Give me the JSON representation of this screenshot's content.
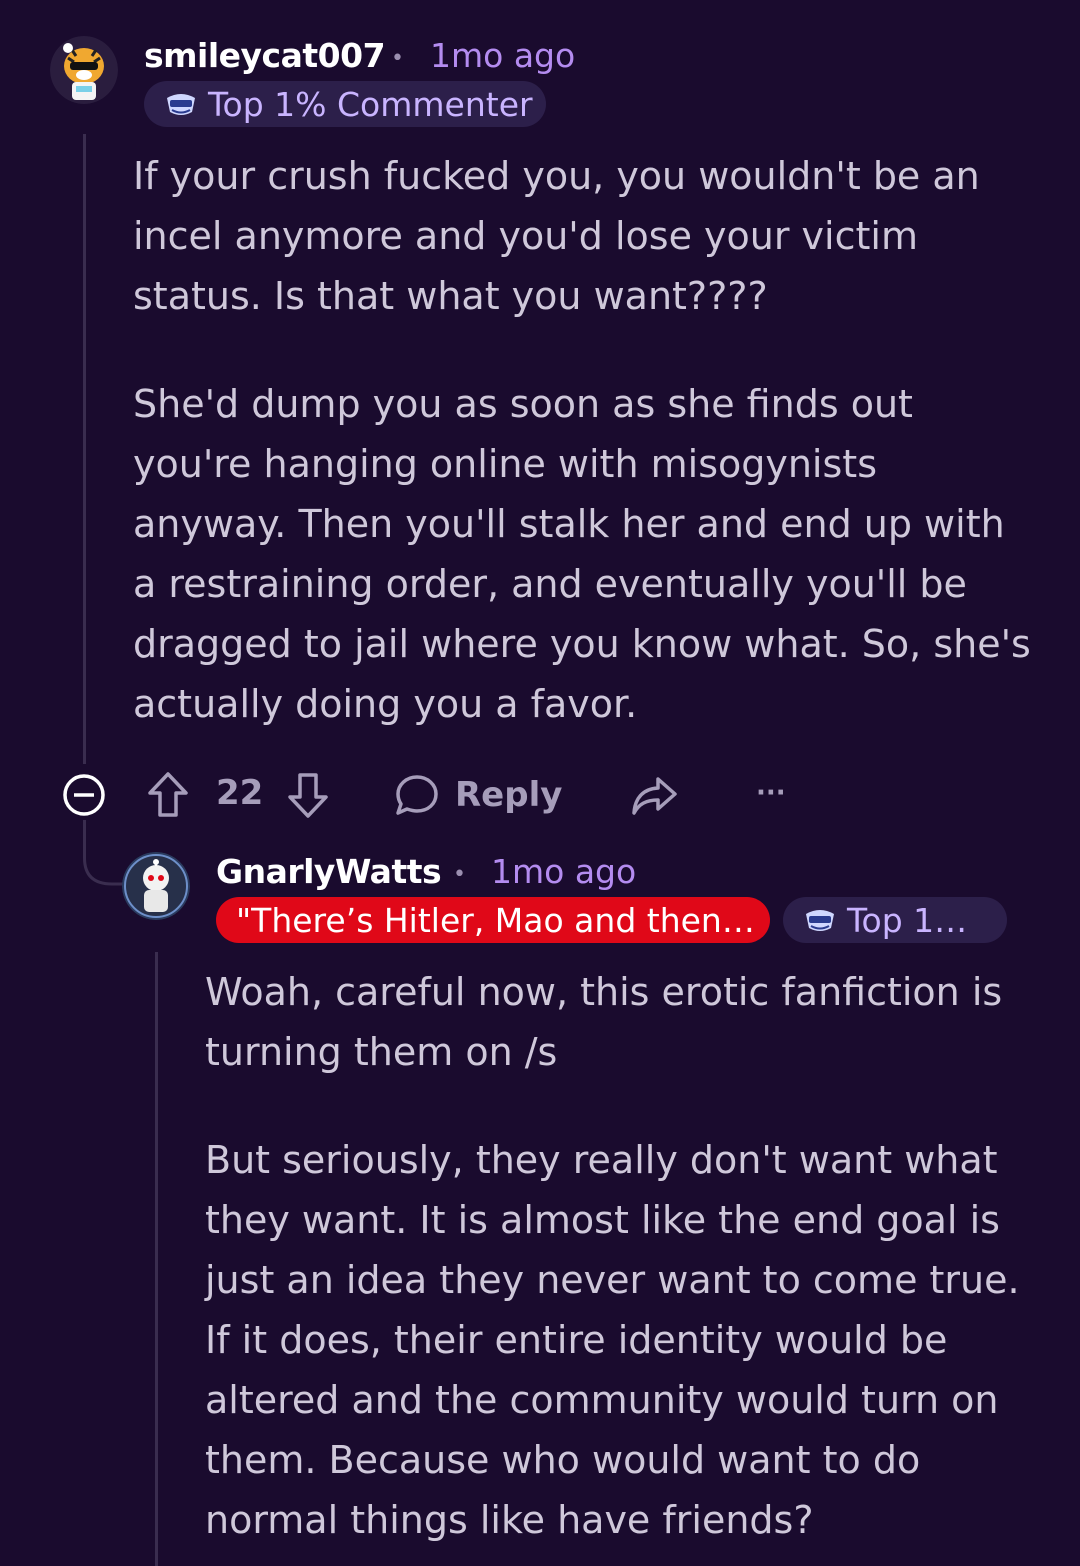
{
  "comments": [
    {
      "username": "smileycat007",
      "separator": "•",
      "time": "1mo ago",
      "flair": "Top 1% Commenter",
      "paragraphs": [
        "If your crush fucked you, you wouldn't be an incel anymore and you'd lose your victim status. Is that what you want????",
        "She'd dump you as soon as she finds out you're hanging online with misogynists anyway. Then you'll stalk her and end up with a restraining order, and eventually you'll be dragged to jail where you know what. So, she's actually doing you a favor."
      ],
      "actions": {
        "vote_count": "22",
        "reply_label": "Reply",
        "more_label": "···"
      }
    },
    {
      "username": "GnarlyWatts",
      "separator": "•",
      "time": "1mo ago",
      "flair_red": "\"There’s Hitler, Mao and then…",
      "flair": "Top 1…",
      "paragraphs": [
        "Woah, careful now, this erotic fanfiction is turning them on /s",
        "But seriously, they really don't want what they want. It is almost like the end goal is just an idea they never want to come true. If it does, their entire identity would be altered and the community would turn on them. Because who would want to do normal things like have friends?"
      ]
    }
  ],
  "icons": {
    "collapse": "collapse-minus-icon",
    "upvote": "arrow-up-icon",
    "downvote": "arrow-down-icon",
    "reply": "speech-bubble-icon",
    "share": "share-arrow-icon",
    "flair": "commenter-badge-icon"
  },
  "colors": {
    "background": "#1a0b2e",
    "time": "#b48cf0",
    "flair_purple": "#2c1f4a",
    "flair_red": "#e00818"
  }
}
